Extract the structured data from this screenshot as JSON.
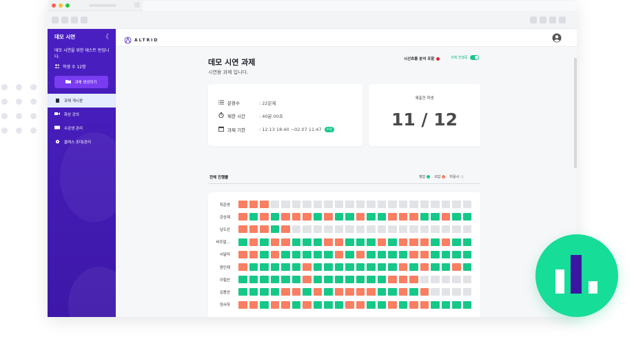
{
  "sidebar": {
    "title": "데모 시연",
    "collapse_icon": "《",
    "description": "데모 시연을 위한 테스트 반입니다.",
    "student_count": "학생 수 12명",
    "create_button": "과제 생성하기",
    "nav": [
      {
        "label": "과제 게시판",
        "icon": "clipboard-icon",
        "active": true
      },
      {
        "label": "화상 강의",
        "icon": "video-icon",
        "active": false
      },
      {
        "label": "수강생 관리",
        "icon": "id-card-icon",
        "active": false
      },
      {
        "label": "클래스 조대/관리",
        "icon": "gear-icon",
        "active": false
      }
    ]
  },
  "header": {
    "logo": "ALTRID"
  },
  "assignment": {
    "title": "데모 시연 과제",
    "subtitle": "시연용 과제 입니다.",
    "gaze_analysis_label": "시선흐름 분석 포함",
    "progress_toggle_label": "과제 진행중",
    "info": [
      {
        "icon": "list-icon",
        "label": "문항수",
        "value": ": 22문제"
      },
      {
        "icon": "stopwatch-icon",
        "label": "제한 시간",
        "value": ": 40분 00초"
      },
      {
        "icon": "calendar-icon",
        "label": "과제 기한",
        "value": ": 12.13 18:40 ~02.07 11:47",
        "badge": "수정"
      }
    ],
    "submitted_label": "제출한 학생",
    "submitted_value": "11 / 12"
  },
  "progress": {
    "title": "전체 진행률",
    "legend": [
      {
        "label": "정답",
        "color": "#16c888"
      },
      {
        "label": "오답",
        "color": "#f97e62"
      },
      {
        "label": "미응시",
        "color": "#e1e3e6"
      }
    ],
    "rows": [
      {
        "name": "최준영",
        "cells": "OOONNNNNNNNNNNNNNNNNNN"
      },
      {
        "name": "강승재",
        "cells": "OGOGOOOGOGGOGGOOOGGOGG"
      },
      {
        "name": "남도산",
        "cells": "OOOGONNNNNNNNNNNNNNNNN"
      },
      {
        "name": "비주얼…",
        "cells": "GOGOOGGGOOGGGOGOOOGOGG"
      },
      {
        "name": "서달미",
        "cells": "OOGOGGGGGOGOGGGGOOGGGG"
      },
      {
        "name": "원인재",
        "cells": "OGGGGGOGGGGGGGGOGOGGOG"
      },
      {
        "name": "이철산",
        "cells": "GGGGGGOGGGGGGGOOONNNNN"
      },
      {
        "name": "김용산",
        "cells": "GGGGOOGOGOOOOGGOGONNNN"
      },
      {
        "name": "정사하",
        "cells": "OOGOOGOGGGOOGGOGOOGGGG"
      }
    ]
  }
}
